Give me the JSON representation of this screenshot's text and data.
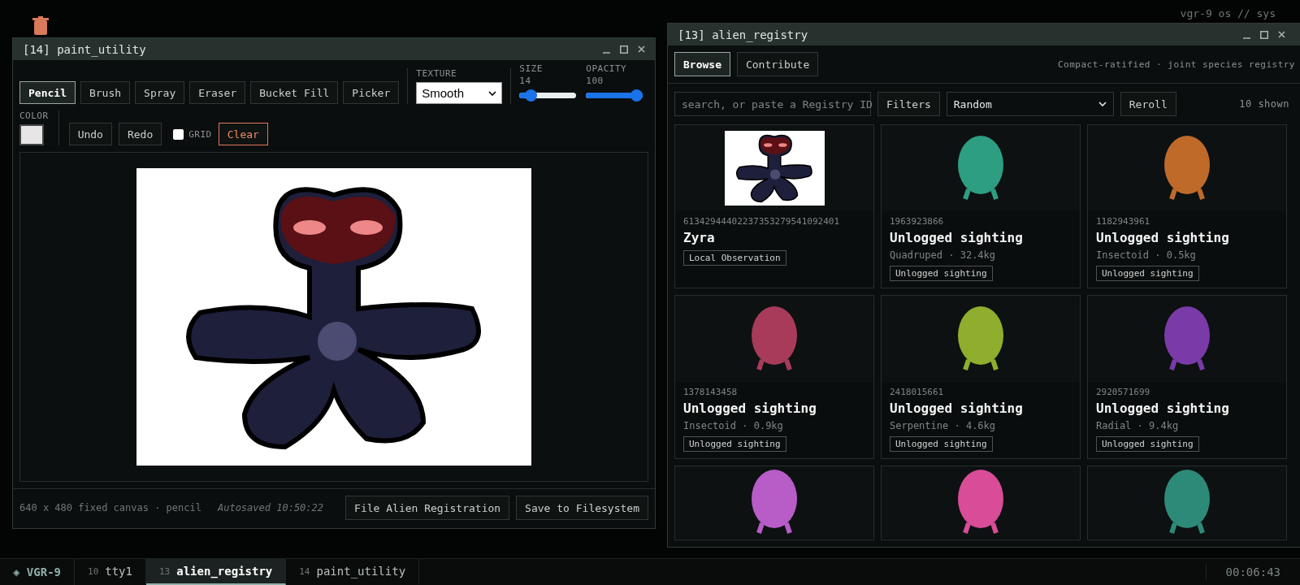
{
  "desktop": {
    "system_label": "vgr-9 os // sys"
  },
  "paint_window": {
    "title": "[14] paint_utility",
    "tools": [
      {
        "label": "Pencil",
        "selected": true
      },
      {
        "label": "Brush",
        "selected": false
      },
      {
        "label": "Spray",
        "selected": false
      },
      {
        "label": "Eraser",
        "selected": false
      },
      {
        "label": "Bucket Fill",
        "selected": false
      },
      {
        "label": "Picker",
        "selected": false
      }
    ],
    "texture": {
      "label": "TEXTURE",
      "value": "Smooth"
    },
    "size": {
      "label": "SIZE",
      "reading": "14",
      "level": 0.13
    },
    "opacity": {
      "label": "OPACITY",
      "reading": "100",
      "level": 1
    },
    "color": {
      "label": "COLOR",
      "color": "#e6e6e6"
    },
    "actions": [
      "Undo",
      "Redo"
    ],
    "grid": {
      "label": "GRID",
      "checked": false
    },
    "clear": "Clear",
    "status": "640 x 480 fixed canvas · pencil",
    "autosave": "Autosaved 10:50:22",
    "buttons": [
      "File Alien Registration",
      "Save to Filesystem"
    ]
  },
  "registry_window": {
    "title": "[13] alien_registry",
    "tabs": [
      {
        "label": "Browse",
        "selected": true
      },
      {
        "label": "Contribute",
        "selected": false
      }
    ],
    "tagline": "Compact-ratified · joint species registry",
    "search": {
      "placeholder": "search, or paste a Registry ID"
    },
    "filters": "Filters",
    "sort": "Random",
    "reroll": "Reroll",
    "count": "10 shown",
    "cards": [
      {
        "kind": "sketch",
        "id": "61342944402237353279541092401",
        "name": "Zyra",
        "tag": "Local Observation"
      },
      {
        "kind": "render",
        "color": "#2e9e82",
        "id": "1963923866",
        "name": "Unlogged sighting",
        "meta": "Quadruped · 32.4kg",
        "tag": "Unlogged sighting"
      },
      {
        "kind": "render",
        "color": "#c06a2a",
        "id": "1182943961",
        "name": "Unlogged sighting",
        "meta": "Insectoid · 0.5kg",
        "tag": "Unlogged sighting"
      },
      {
        "kind": "render",
        "color": "#a83a5a",
        "id": "1378143458",
        "name": "Unlogged sighting",
        "meta": "Insectoid · 0.9kg",
        "tag": "Unlogged sighting"
      },
      {
        "kind": "render",
        "color": "#8fae2e",
        "id": "2418015661",
        "name": "Unlogged sighting",
        "meta": "Serpentine · 4.6kg",
        "tag": "Unlogged sighting"
      },
      {
        "kind": "render",
        "color": "#7a3aa8",
        "id": "2920571699",
        "name": "Unlogged sighting",
        "meta": "Radial · 9.4kg",
        "tag": "Unlogged sighting"
      },
      {
        "kind": "render",
        "color": "#b85cc8"
      },
      {
        "kind": "render",
        "color": "#d84c98"
      },
      {
        "kind": "render",
        "color": "#2e8a78"
      }
    ]
  },
  "taskbar": {
    "brand": "◈ VGR-9",
    "tasks": [
      {
        "number": "10",
        "label": "tty1",
        "selected": false
      },
      {
        "number": "13",
        "label": "alien_registry",
        "selected": true
      },
      {
        "number": "14",
        "label": "paint_utility",
        "selected": false
      }
    ],
    "clock": "00:06:43"
  }
}
